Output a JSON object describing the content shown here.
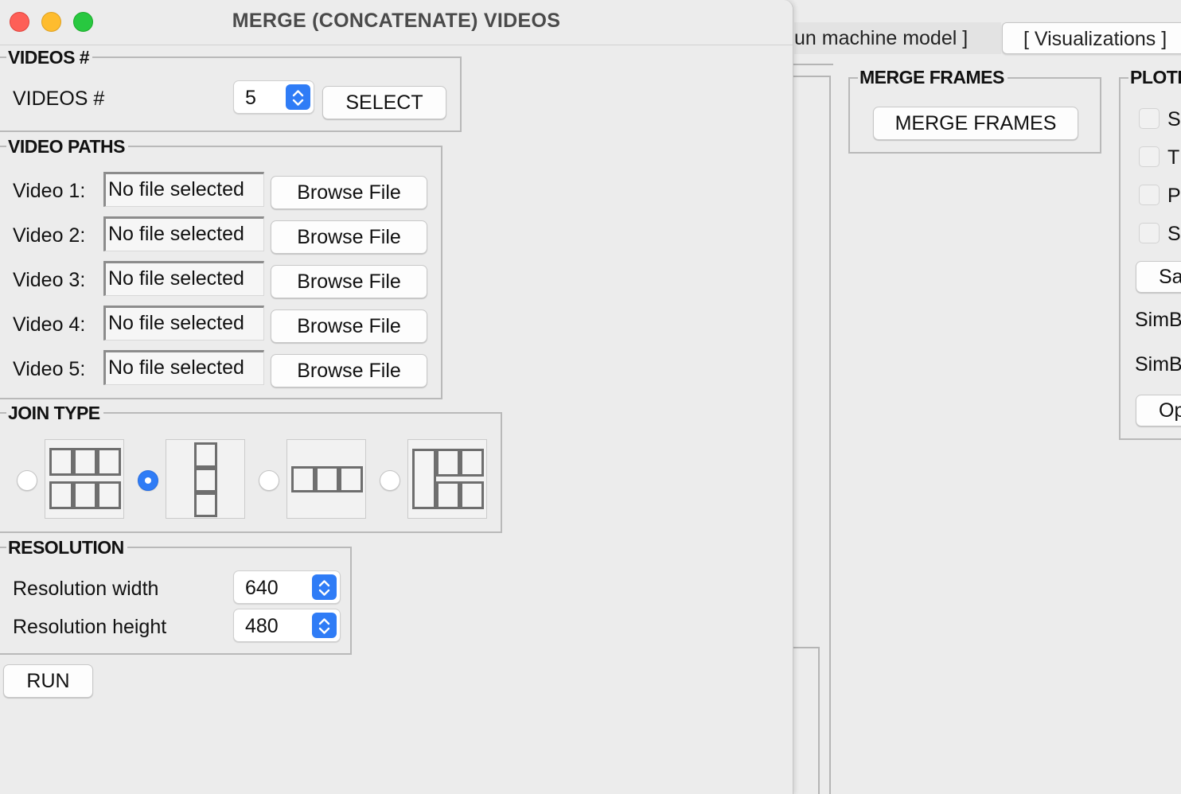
{
  "background_window": {
    "tabs": [
      {
        "label": "un machine model ]"
      },
      {
        "label": "[ Visualizations ]"
      }
    ],
    "merge_frames_group": {
      "title": "MERGE FRAMES",
      "button_label": "MERGE FRAMES"
    },
    "plot_group": {
      "title": "PLOTI",
      "checkbox_letters": [
        "S",
        "T",
        "P",
        "S"
      ],
      "button_1": "Sa",
      "label_1": "SimB",
      "label_2": "SimB",
      "button_2": "Op"
    }
  },
  "dialog": {
    "title": "MERGE (CONCATENATE) VIDEOS",
    "videos_group": {
      "title": "VIDEOS #",
      "label": "VIDEOS #",
      "count_value": "5",
      "select_button": "SELECT"
    },
    "paths_group": {
      "title": "VIDEO PATHS",
      "rows": [
        {
          "label": "Video 1:",
          "path": "No file selected",
          "button": "Browse File"
        },
        {
          "label": "Video 2:",
          "path": "No file selected",
          "button": "Browse File"
        },
        {
          "label": "Video 3:",
          "path": "No file selected",
          "button": "Browse File"
        },
        {
          "label": "Video 4:",
          "path": "No file selected",
          "button": "Browse File"
        },
        {
          "label": "Video 5:",
          "path": "No file selected",
          "button": "Browse File"
        }
      ]
    },
    "join_group": {
      "title": "JOIN TYPE",
      "options": [
        {
          "layout": "mosaic-grid-3x2",
          "selected": false
        },
        {
          "layout": "vertical-stack",
          "selected": true
        },
        {
          "layout": "horizontal-row",
          "selected": false
        },
        {
          "layout": "mixed-mosaic",
          "selected": false
        }
      ]
    },
    "resolution_group": {
      "title": "RESOLUTION",
      "width_label": "Resolution width",
      "width_value": "640",
      "height_label": "Resolution height",
      "height_value": "480"
    },
    "run_button": "RUN"
  },
  "colors": {
    "accent": "#2f7cf6",
    "close": "#fe5f57",
    "minimize": "#febc2e",
    "maximize": "#28c840"
  }
}
